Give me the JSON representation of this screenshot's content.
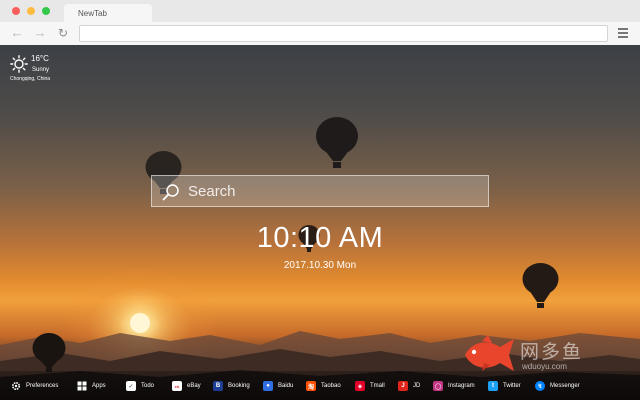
{
  "browser": {
    "tab_title": "NewTab",
    "address": ""
  },
  "weather": {
    "temperature": "16°C",
    "condition": "Sunny",
    "location": "Chongqing,  China"
  },
  "search": {
    "placeholder": "Search"
  },
  "clock": {
    "time": "10:10 AM",
    "date": "2017.10.30 Mon"
  },
  "watermark": {
    "brand_cn": "网多鱼",
    "brand_en": "wduoyu.com",
    "color": "#e8452c"
  },
  "bottom_bar": {
    "preferences": "Preferences",
    "apps": "Apps",
    "todo": "Todo",
    "ebay": "eBay",
    "booking": "Booking",
    "baidu": "Baidu",
    "taobao": "Taobao",
    "tmall": "Tmall",
    "jd": "JD",
    "instagram": "Instagram",
    "twitter": "Twitter",
    "messenger": "Messenger"
  },
  "icons": {
    "booking_color": "#1c3f94",
    "baidu_color": "#2f6de1",
    "taobao_color": "#ff5000",
    "tmall_color": "#e4002b",
    "jd_color": "#e1251b",
    "instagram_color": "#c13584",
    "twitter_color": "#1da1f2",
    "messenger_color": "#0084ff"
  }
}
